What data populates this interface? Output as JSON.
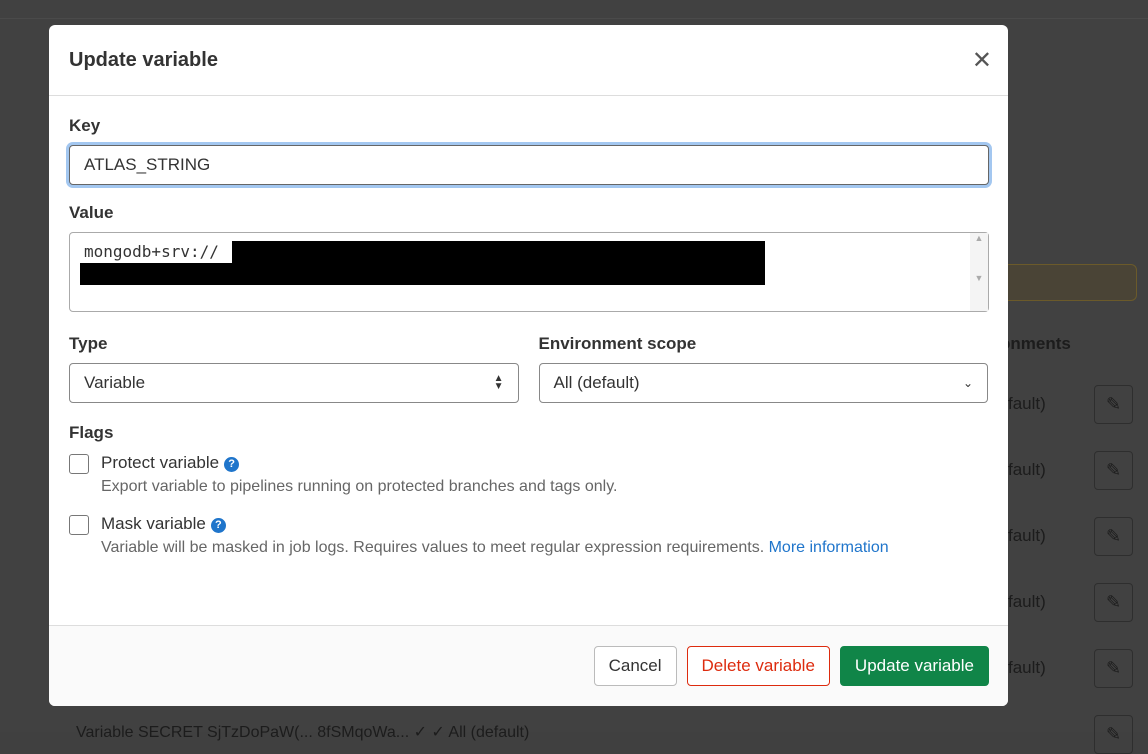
{
  "modal": {
    "title": "Update variable",
    "key_label": "Key",
    "key_value": "ATLAS_STRING",
    "value_label": "Value",
    "value_text": "mongodb+srv://",
    "type_label": "Type",
    "type_value": "Variable",
    "env_label": "Environment scope",
    "env_value": "All (default)",
    "flags_label": "Flags",
    "protect": {
      "label": "Protect variable",
      "desc": "Export variable to pipelines running on protected branches and tags only.",
      "checked": false
    },
    "mask": {
      "label": "Mask variable",
      "desc": "Variable will be masked in job logs. Requires values to meet regular expression requirements. ",
      "link": "More information",
      "checked": false
    },
    "cancel": "Cancel",
    "delete": "Delete variable",
    "update": "Update variable"
  },
  "background": {
    "header": "onments",
    "rows": [
      "fault)",
      "fault)",
      "fault)",
      "fault)",
      "fault)"
    ],
    "last_row": "Variable   SECRET                    SjTzDoPaW(...   8fSMqoWa...   ✓            ✓            All (default)"
  },
  "colors": {
    "primary": "#108548",
    "danger": "#dd2b0e",
    "link": "#1f75cb"
  }
}
